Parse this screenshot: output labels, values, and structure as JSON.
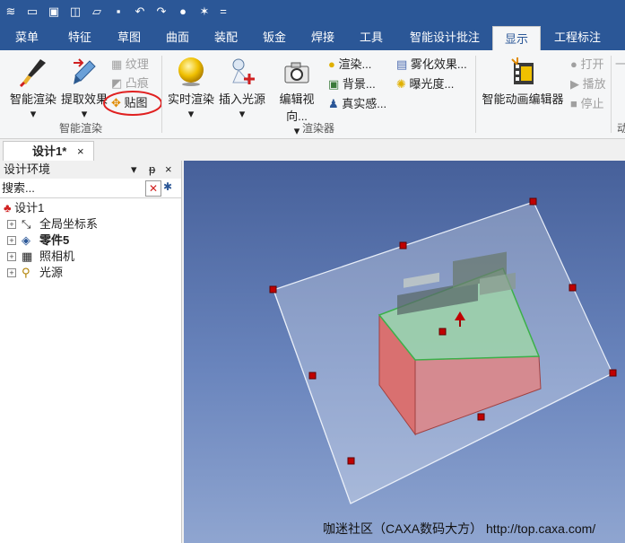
{
  "quick_access": {
    "more_label": "="
  },
  "menu_tabs": [
    {
      "label": "菜单"
    },
    {
      "label": "特征"
    },
    {
      "label": "草图"
    },
    {
      "label": "曲面"
    },
    {
      "label": "装配"
    },
    {
      "label": "钣金"
    },
    {
      "label": "焊接"
    },
    {
      "label": "工具"
    },
    {
      "label": "智能设计批注"
    },
    {
      "label": "显示"
    },
    {
      "label": "工程标注"
    }
  ],
  "ribbon": {
    "groups": {
      "smart_render": "智能渲染",
      "renderer": "渲染器"
    },
    "smart_render": {
      "smart_render_label": "智能渲染",
      "extract_effect_label": "提取效果",
      "texture_label": "纹理",
      "bump_label": "凸痕",
      "decal_label": "贴图"
    },
    "renderer": {
      "realtime_render_label": "实时渲染",
      "insert_light_label": "插入光源",
      "edit_view_label": "编辑视向...",
      "render_label": "渲染...",
      "background_label": "背景...",
      "realism_label": "真实感...",
      "fog_label": "雾化效果...",
      "exposure_label": "曝光度..."
    },
    "animation": {
      "editor_label": "智能动画编辑器",
      "open_label": "打开",
      "play_label": "播放",
      "stop_label": "停止",
      "cut_group_label": "动",
      "cut_item_label": "一"
    }
  },
  "document_tab": {
    "label": "设计1*",
    "close": "×"
  },
  "design_panel": {
    "title": "设计环境",
    "pin": "ᵽ",
    "close": "×",
    "search_placeholder": "搜索...",
    "tree": [
      {
        "label": "设计1"
      },
      {
        "label": "全局坐标系"
      },
      {
        "label": "零件5"
      },
      {
        "label": "照相机"
      },
      {
        "label": "光源"
      }
    ]
  },
  "viewport": {
    "watermark": "咖迷社区（CAXA数码大方） http://top.caxa.com/"
  },
  "colors": {
    "accent": "#2b5797",
    "annotation_circle": "#e02020",
    "box_front": "#d97070",
    "box_top": "#9ed4a8",
    "handle": "#c00000"
  }
}
